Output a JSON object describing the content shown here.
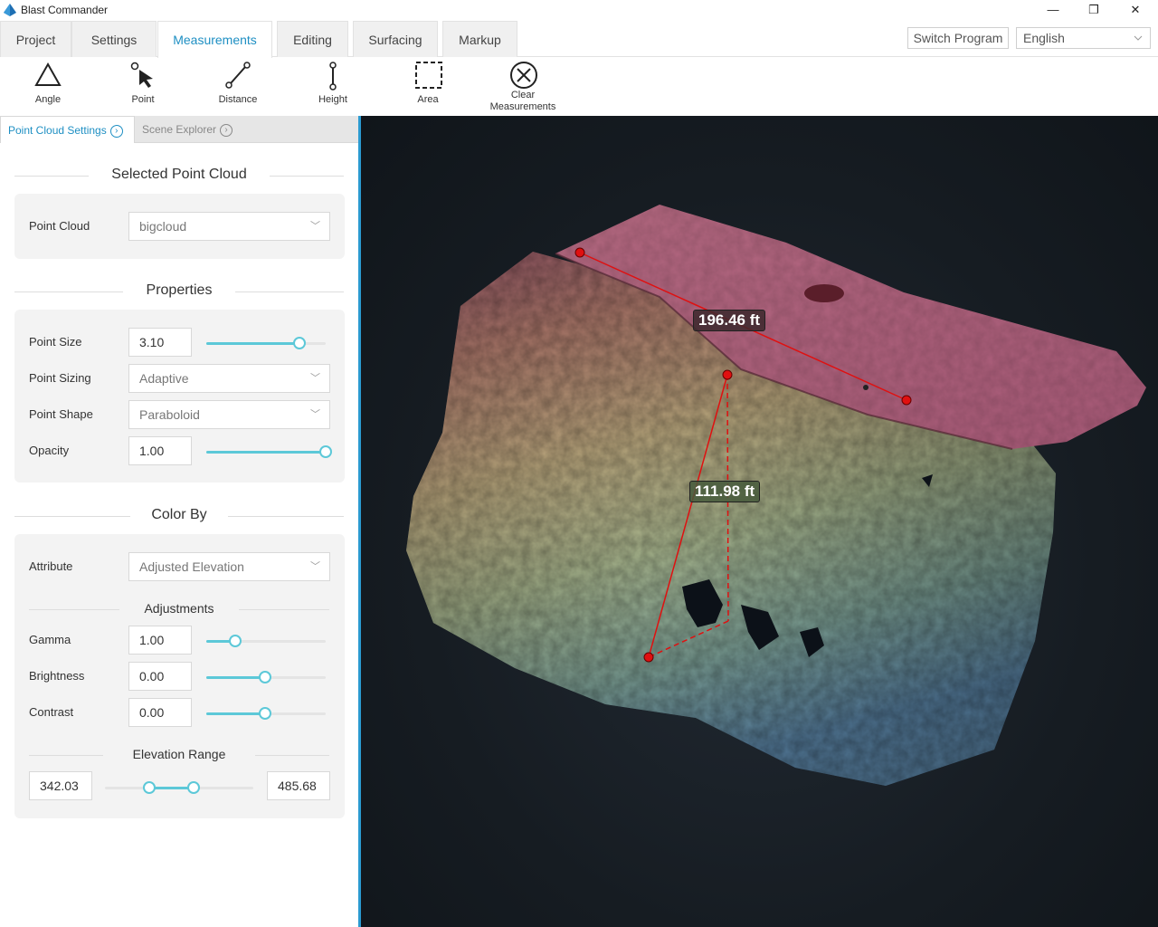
{
  "window": {
    "title": "Blast Commander",
    "minimize": "—",
    "maximize": "❐",
    "close": "✕"
  },
  "tabs": [
    {
      "label": "Project",
      "active": false
    },
    {
      "label": "Settings",
      "active": false
    },
    {
      "label": "Measurements",
      "active": true
    },
    {
      "label": "Editing",
      "active": false
    },
    {
      "label": "Surfacing",
      "active": false
    },
    {
      "label": "Markup",
      "active": false
    }
  ],
  "switch_program": "Switch Program",
  "language": {
    "selected": "English"
  },
  "ribbon": {
    "angle": "Angle",
    "point": "Point",
    "distance": "Distance",
    "height": "Height",
    "area": "Area",
    "clear_line1": "Clear",
    "clear_line2": "Measurements"
  },
  "panel_tabs": {
    "point_cloud_settings": "Point Cloud Settings",
    "scene_explorer": "Scene Explorer"
  },
  "selected_point_cloud": {
    "heading": "Selected Point Cloud",
    "label": "Point Cloud",
    "value": "bigcloud"
  },
  "properties": {
    "heading": "Properties",
    "point_size": {
      "label": "Point Size",
      "value": "3.10",
      "slider": 0.78
    },
    "point_sizing": {
      "label": "Point Sizing",
      "value": "Adaptive"
    },
    "point_shape": {
      "label": "Point Shape",
      "value": "Paraboloid"
    },
    "opacity": {
      "label": "Opacity",
      "value": "1.00",
      "slider": 1.0
    }
  },
  "color_by": {
    "heading": "Color By",
    "attribute": {
      "label": "Attribute",
      "value": "Adjusted Elevation"
    },
    "adjustments_heading": "Adjustments",
    "gamma": {
      "label": "Gamma",
      "value": "1.00",
      "slider": 0.24
    },
    "brightness": {
      "label": "Brightness",
      "value": "0.00",
      "slider": 0.49
    },
    "contrast": {
      "label": "Contrast",
      "value": "0.00",
      "slider": 0.49
    },
    "elevation_range": {
      "heading": "Elevation Range",
      "min": "342.03",
      "max": "485.68",
      "low": 0.3,
      "high": 0.6
    }
  },
  "measurements": {
    "distance_label": "196.46 ft",
    "height_label": "111.98 ft"
  },
  "colors": {
    "accent": "#1e8fc3",
    "slider": "#5cc8d8",
    "marker": "#e01010"
  }
}
